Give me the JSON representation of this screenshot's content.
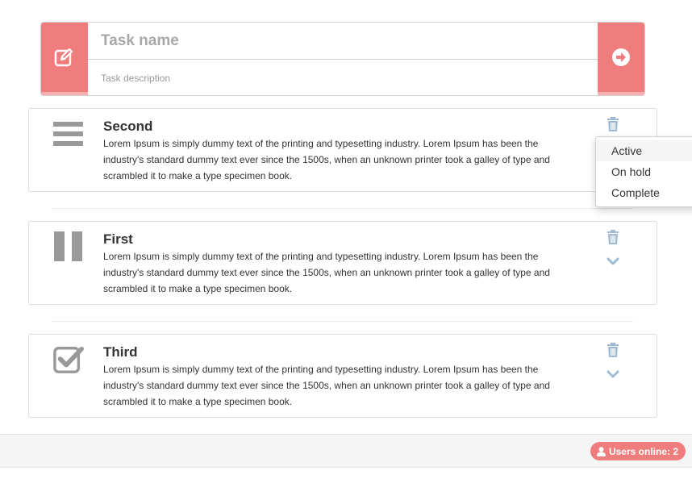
{
  "form": {
    "name_placeholder": "Task name",
    "description_placeholder": "Task description",
    "edit_icon": "edit-icon",
    "submit_icon": "arrow-circle-right-icon"
  },
  "tasks": [
    {
      "title": "Second",
      "status_icon": "list-icon",
      "description": "Lorem Ipsum is simply dummy text of the printing and typesetting industry. Lorem Ipsum has been the industry's standard dummy text ever since the 1500s, when an unknown printer took a galley of type and scrambled it to make a type specimen book."
    },
    {
      "title": "First",
      "status_icon": "pause-icon",
      "description": "Lorem Ipsum is simply dummy text of the printing and typesetting industry. Lorem Ipsum has been the industry's standard dummy text ever since the 1500s, when an unknown printer took a galley of type and scrambled it to make a type specimen book."
    },
    {
      "title": "Third",
      "status_icon": "check-square-icon",
      "description": "Lorem Ipsum is simply dummy text of the printing and typesetting industry. Lorem Ipsum has been the industry's standard dummy text ever since the 1500s, when an unknown printer took a galley of type and scrambled it to make a type specimen book."
    }
  ],
  "status_menu": {
    "items": [
      "Active",
      "On hold",
      "Complete"
    ],
    "highlighted": "Active"
  },
  "footer": {
    "users_online_label": "Users online: 2"
  },
  "colors": {
    "accent": "#f07d7d",
    "icon_gray": "#999999",
    "action_blue": "#9fbad3"
  }
}
